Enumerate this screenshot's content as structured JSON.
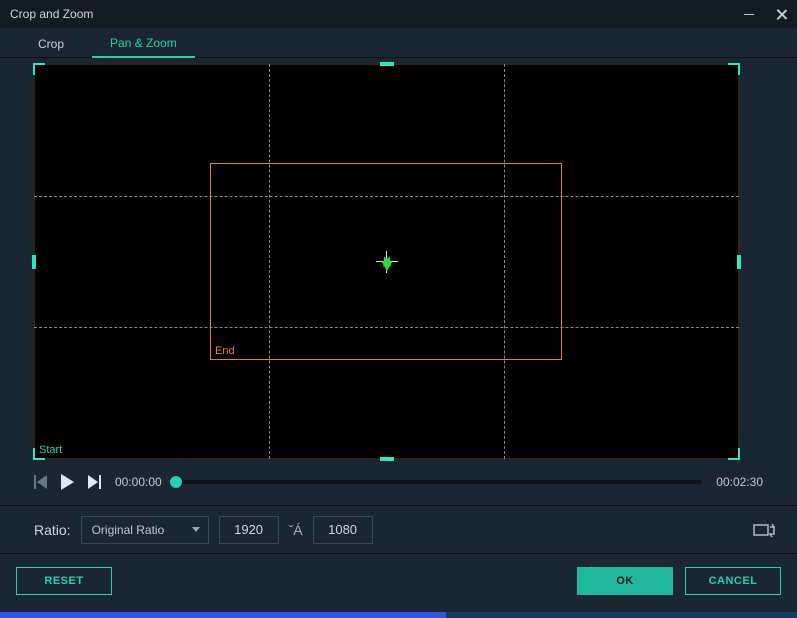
{
  "window": {
    "title": "Crop and Zoom"
  },
  "tabs": {
    "crop": "Crop",
    "pan_zoom": "Pan & Zoom"
  },
  "preview": {
    "start_label": "Start",
    "end_label": "End"
  },
  "playback": {
    "current": "00:00:00",
    "total": "00:02:30"
  },
  "ratio": {
    "label": "Ratio:",
    "selected": "Original Ratio",
    "separator": "ˇÁ",
    "width": "1920",
    "height": "1080"
  },
  "buttons": {
    "reset": "RESET",
    "ok": "OK",
    "cancel": "CANCEL"
  }
}
